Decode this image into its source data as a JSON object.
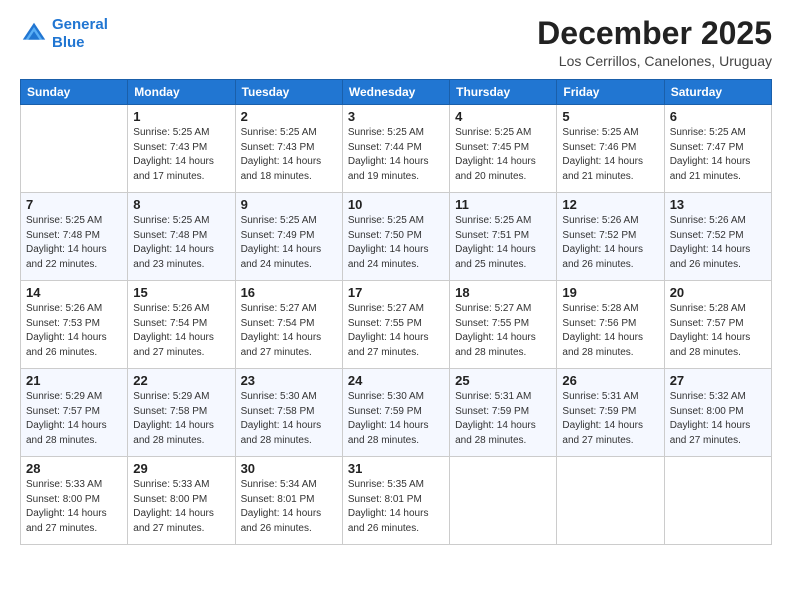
{
  "logo": {
    "line1": "General",
    "line2": "Blue"
  },
  "title": "December 2025",
  "location": "Los Cerrillos, Canelones, Uruguay",
  "days_of_week": [
    "Sunday",
    "Monday",
    "Tuesday",
    "Wednesday",
    "Thursday",
    "Friday",
    "Saturday"
  ],
  "weeks": [
    [
      {
        "num": "",
        "info": ""
      },
      {
        "num": "1",
        "info": "Sunrise: 5:25 AM\nSunset: 7:43 PM\nDaylight: 14 hours\nand 17 minutes."
      },
      {
        "num": "2",
        "info": "Sunrise: 5:25 AM\nSunset: 7:43 PM\nDaylight: 14 hours\nand 18 minutes."
      },
      {
        "num": "3",
        "info": "Sunrise: 5:25 AM\nSunset: 7:44 PM\nDaylight: 14 hours\nand 19 minutes."
      },
      {
        "num": "4",
        "info": "Sunrise: 5:25 AM\nSunset: 7:45 PM\nDaylight: 14 hours\nand 20 minutes."
      },
      {
        "num": "5",
        "info": "Sunrise: 5:25 AM\nSunset: 7:46 PM\nDaylight: 14 hours\nand 21 minutes."
      },
      {
        "num": "6",
        "info": "Sunrise: 5:25 AM\nSunset: 7:47 PM\nDaylight: 14 hours\nand 21 minutes."
      }
    ],
    [
      {
        "num": "7",
        "info": "Sunrise: 5:25 AM\nSunset: 7:48 PM\nDaylight: 14 hours\nand 22 minutes."
      },
      {
        "num": "8",
        "info": "Sunrise: 5:25 AM\nSunset: 7:48 PM\nDaylight: 14 hours\nand 23 minutes."
      },
      {
        "num": "9",
        "info": "Sunrise: 5:25 AM\nSunset: 7:49 PM\nDaylight: 14 hours\nand 24 minutes."
      },
      {
        "num": "10",
        "info": "Sunrise: 5:25 AM\nSunset: 7:50 PM\nDaylight: 14 hours\nand 24 minutes."
      },
      {
        "num": "11",
        "info": "Sunrise: 5:25 AM\nSunset: 7:51 PM\nDaylight: 14 hours\nand 25 minutes."
      },
      {
        "num": "12",
        "info": "Sunrise: 5:26 AM\nSunset: 7:52 PM\nDaylight: 14 hours\nand 26 minutes."
      },
      {
        "num": "13",
        "info": "Sunrise: 5:26 AM\nSunset: 7:52 PM\nDaylight: 14 hours\nand 26 minutes."
      }
    ],
    [
      {
        "num": "14",
        "info": "Sunrise: 5:26 AM\nSunset: 7:53 PM\nDaylight: 14 hours\nand 26 minutes."
      },
      {
        "num": "15",
        "info": "Sunrise: 5:26 AM\nSunset: 7:54 PM\nDaylight: 14 hours\nand 27 minutes."
      },
      {
        "num": "16",
        "info": "Sunrise: 5:27 AM\nSunset: 7:54 PM\nDaylight: 14 hours\nand 27 minutes."
      },
      {
        "num": "17",
        "info": "Sunrise: 5:27 AM\nSunset: 7:55 PM\nDaylight: 14 hours\nand 27 minutes."
      },
      {
        "num": "18",
        "info": "Sunrise: 5:27 AM\nSunset: 7:55 PM\nDaylight: 14 hours\nand 28 minutes."
      },
      {
        "num": "19",
        "info": "Sunrise: 5:28 AM\nSunset: 7:56 PM\nDaylight: 14 hours\nand 28 minutes."
      },
      {
        "num": "20",
        "info": "Sunrise: 5:28 AM\nSunset: 7:57 PM\nDaylight: 14 hours\nand 28 minutes."
      }
    ],
    [
      {
        "num": "21",
        "info": "Sunrise: 5:29 AM\nSunset: 7:57 PM\nDaylight: 14 hours\nand 28 minutes."
      },
      {
        "num": "22",
        "info": "Sunrise: 5:29 AM\nSunset: 7:58 PM\nDaylight: 14 hours\nand 28 minutes."
      },
      {
        "num": "23",
        "info": "Sunrise: 5:30 AM\nSunset: 7:58 PM\nDaylight: 14 hours\nand 28 minutes."
      },
      {
        "num": "24",
        "info": "Sunrise: 5:30 AM\nSunset: 7:59 PM\nDaylight: 14 hours\nand 28 minutes."
      },
      {
        "num": "25",
        "info": "Sunrise: 5:31 AM\nSunset: 7:59 PM\nDaylight: 14 hours\nand 28 minutes."
      },
      {
        "num": "26",
        "info": "Sunrise: 5:31 AM\nSunset: 7:59 PM\nDaylight: 14 hours\nand 27 minutes."
      },
      {
        "num": "27",
        "info": "Sunrise: 5:32 AM\nSunset: 8:00 PM\nDaylight: 14 hours\nand 27 minutes."
      }
    ],
    [
      {
        "num": "28",
        "info": "Sunrise: 5:33 AM\nSunset: 8:00 PM\nDaylight: 14 hours\nand 27 minutes."
      },
      {
        "num": "29",
        "info": "Sunrise: 5:33 AM\nSunset: 8:00 PM\nDaylight: 14 hours\nand 27 minutes."
      },
      {
        "num": "30",
        "info": "Sunrise: 5:34 AM\nSunset: 8:01 PM\nDaylight: 14 hours\nand 26 minutes."
      },
      {
        "num": "31",
        "info": "Sunrise: 5:35 AM\nSunset: 8:01 PM\nDaylight: 14 hours\nand 26 minutes."
      },
      {
        "num": "",
        "info": ""
      },
      {
        "num": "",
        "info": ""
      },
      {
        "num": "",
        "info": ""
      }
    ]
  ]
}
